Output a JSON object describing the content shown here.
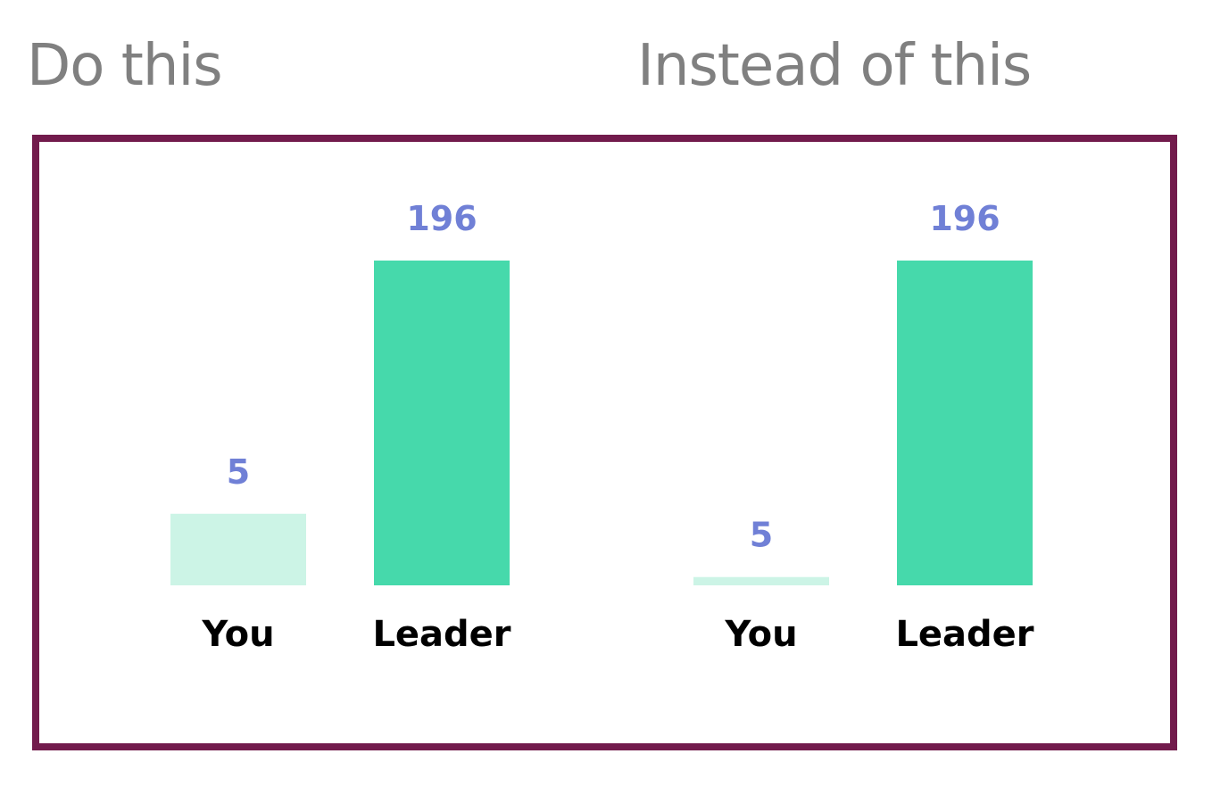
{
  "headings": {
    "left": "Do this",
    "right": "Instead of this"
  },
  "colors": {
    "frame": "#721b4c",
    "heading": "#808080",
    "value_label": "#7080d6",
    "category_label": "#000000",
    "bar_you": "#ccf4e6",
    "bar_leader": "#46d9ab"
  },
  "chart_data": [
    {
      "type": "bar",
      "categories": [
        "You",
        "Leader"
      ],
      "values": [
        5,
        196
      ],
      "ylim": [
        -49,
        196
      ],
      "axis_visible": false,
      "grid": false,
      "data_labels": [
        "5",
        "196"
      ]
    },
    {
      "type": "bar",
      "categories": [
        "You",
        "Leader"
      ],
      "values": [
        5,
        196
      ],
      "ylim": [
        0,
        196
      ],
      "axis_visible": false,
      "grid": false,
      "data_labels": [
        "5",
        "196"
      ]
    }
  ]
}
